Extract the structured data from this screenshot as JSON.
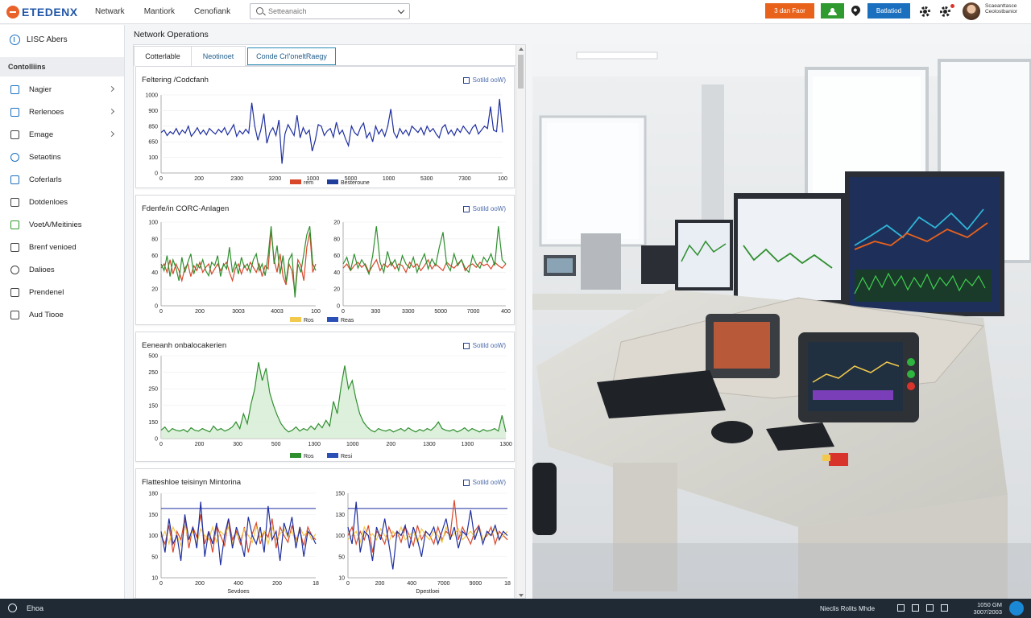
{
  "app": {
    "logo": "ETEDENX",
    "nav": [
      "Netwark",
      "Mantiork",
      "Cenofiank"
    ],
    "search_placeholder": "Setteanaich",
    "btn_orange": "3 dan Faor",
    "btn_blue": "Batlatiod",
    "user_line1": "Scaeanttasce",
    "user_line2": "Ceolostbanior"
  },
  "sidebar": {
    "header": "LISC Abers",
    "section": "Contolliins",
    "items": [
      {
        "label": "Nagier",
        "icon": "document-icon",
        "arrow": true
      },
      {
        "label": "Rerlenoes",
        "icon": "page-icon",
        "arrow": true
      },
      {
        "label": "Emage",
        "icon": "tag-icon",
        "arrow": true
      },
      {
        "label": "Setaotins",
        "icon": "clock-icon",
        "arrow": false
      },
      {
        "label": "Coferlarls",
        "icon": "card-icon",
        "arrow": false
      },
      {
        "label": "Dotdenloes",
        "icon": "grid-icon",
        "arrow": false
      },
      {
        "label": "VoetA/Meitinies",
        "icon": "chart-icon",
        "arrow": false
      },
      {
        "label": "Brenf venioed",
        "icon": "chart-bars-icon",
        "arrow": false
      },
      {
        "label": "Dalioes",
        "icon": "search-icon",
        "arrow": false
      },
      {
        "label": "Prendenel",
        "icon": "list-icon",
        "arrow": false
      },
      {
        "label": "Aud Tiooe",
        "icon": "star-icon",
        "arrow": false
      }
    ]
  },
  "main": {
    "title": "Network Operations",
    "tabs": [
      "Cotterlable",
      "Neotinoet",
      "Conde Crl'oneltRaegy"
    ],
    "panels": [
      {
        "title": "Feltering /Codcfanh",
        "link": "Sotild ooW)"
      },
      {
        "title": "Fdenfe/in CORC-Anlagen",
        "link": "Sotild ooW)"
      },
      {
        "title": "Eeneanh onbalocakerien",
        "link": "Sotild ooW)"
      },
      {
        "title": "Flatteshloe teisinyn Mintorina",
        "link": "Sotild ooW)"
      }
    ]
  },
  "chart_data": [
    {
      "type": "line",
      "panel": 1,
      "ytick_labels": [
        "1000",
        "900",
        "850",
        "650",
        "100",
        "0"
      ],
      "xtick_labels": [
        "0",
        "200",
        "2300",
        "3200",
        "1000",
        "5000",
        "1000",
        "5300",
        "7300",
        "100"
      ],
      "legend": [
        {
          "color": "#d9472b",
          "label": "rem"
        },
        {
          "color": "#1f3e9c",
          "label": "Besteroune"
        }
      ],
      "series_color": "#1f2fa0",
      "values": [
        0.52,
        0.55,
        0.48,
        0.53,
        0.5,
        0.57,
        0.49,
        0.55,
        0.51,
        0.6,
        0.47,
        0.52,
        0.58,
        0.5,
        0.55,
        0.49,
        0.57,
        0.53,
        0.5,
        0.56,
        0.52,
        0.58,
        0.49,
        0.55,
        0.62,
        0.47,
        0.54,
        0.5,
        0.56,
        0.51,
        0.9,
        0.6,
        0.42,
        0.55,
        0.76,
        0.38,
        0.52,
        0.58,
        0.48,
        0.68,
        0.12,
        0.5,
        0.62,
        0.55,
        0.48,
        0.74,
        0.45,
        0.58,
        0.5,
        0.55,
        0.28,
        0.42,
        0.62,
        0.6,
        0.48,
        0.54,
        0.57,
        0.46,
        0.65,
        0.5,
        0.55,
        0.44,
        0.35,
        0.6,
        0.52,
        0.48,
        0.58,
        0.64,
        0.45,
        0.52,
        0.4,
        0.6,
        0.5,
        0.56,
        0.47,
        0.6,
        0.82,
        0.52,
        0.45,
        0.57,
        0.5,
        0.55,
        0.48,
        0.6,
        0.56,
        0.52,
        0.58,
        0.49,
        0.6,
        0.53,
        0.57,
        0.5,
        0.45,
        0.58,
        0.62,
        0.5,
        0.55,
        0.48,
        0.57,
        0.52,
        0.6,
        0.55,
        0.5,
        0.58,
        0.62,
        0.5,
        0.55,
        0.6,
        0.57,
        0.85,
        0.55,
        0.53,
        0.95,
        0.52
      ]
    },
    {
      "type": "line",
      "panel": 2,
      "subchart": "left",
      "ytick_labels": [
        "100",
        "80",
        "60",
        "40",
        "20",
        "0"
      ],
      "xtick_labels": [
        "0",
        "200",
        "3003",
        "4003",
        "100"
      ],
      "series": [
        {
          "color": "#d9472b",
          "values": [
            0.45,
            0.5,
            0.4,
            0.55,
            0.38,
            0.5,
            0.42,
            0.3,
            0.45,
            0.5,
            0.35,
            0.48,
            0.42,
            0.52,
            0.4,
            0.46,
            0.5,
            0.38,
            0.44,
            0.5,
            0.42,
            0.48,
            0.52,
            0.4,
            0.3,
            0.45,
            0.5,
            0.38,
            0.48,
            0.42,
            0.52,
            0.46,
            0.4,
            0.5,
            0.35,
            0.48,
            0.44,
            0.9,
            0.55,
            0.4,
            0.62,
            0.35,
            0.25,
            0.5,
            0.42,
            0.15,
            0.55,
            0.48,
            0.3,
            0.7,
            0.88,
            0.4,
            0.5
          ]
        },
        {
          "color": "#2f8f2f",
          "values": [
            0.5,
            0.42,
            0.6,
            0.35,
            0.55,
            0.45,
            0.3,
            0.58,
            0.4,
            0.52,
            0.62,
            0.38,
            0.5,
            0.45,
            0.55,
            0.42,
            0.36,
            0.52,
            0.48,
            0.6,
            0.35,
            0.5,
            0.44,
            0.7,
            0.4,
            0.52,
            0.38,
            0.58,
            0.46,
            0.5,
            0.4,
            0.55,
            0.62,
            0.42,
            0.5,
            0.36,
            0.6,
            0.95,
            0.5,
            0.72,
            0.38,
            0.6,
            0.28,
            0.55,
            0.62,
            0.1,
            0.5,
            0.4,
            0.62,
            0.85,
            0.95,
            0.5,
            0.42
          ]
        }
      ]
    },
    {
      "type": "line",
      "panel": 2,
      "subchart": "right",
      "ytick_labels": [
        "20",
        "80",
        "60",
        "40",
        "20",
        "0"
      ],
      "xtick_labels": [
        "0",
        "300",
        "3300",
        "5000",
        "7000",
        "400"
      ],
      "legend": [
        {
          "color": "#f2c94c",
          "label": "Ros"
        },
        {
          "color": "#2a4fb5",
          "label": "Reas"
        }
      ],
      "series": [
        {
          "color": "#d9472b",
          "values": [
            0.45,
            0.5,
            0.42,
            0.48,
            0.52,
            0.46,
            0.5,
            0.4,
            0.48,
            0.55,
            0.42,
            0.5,
            0.46,
            0.52,
            0.44,
            0.5,
            0.48,
            0.4,
            0.52,
            0.46,
            0.5,
            0.42,
            0.48,
            0.55,
            0.44,
            0.5,
            0.46,
            0.42,
            0.52,
            0.48,
            0.45,
            0.5,
            0.55,
            0.42,
            0.48,
            0.5,
            0.46,
            0.52,
            0.48,
            0.5,
            0.44,
            0.52,
            0.48,
            0.45,
            0.5
          ]
        },
        {
          "color": "#2f8f2f",
          "values": [
            0.5,
            0.58,
            0.42,
            0.62,
            0.45,
            0.55,
            0.48,
            0.38,
            0.6,
            0.95,
            0.52,
            0.4,
            0.65,
            0.48,
            0.55,
            0.42,
            0.6,
            0.5,
            0.45,
            0.58,
            0.4,
            0.52,
            0.62,
            0.44,
            0.56,
            0.48,
            0.7,
            0.88,
            0.5,
            0.42,
            0.62,
            0.48,
            0.55,
            0.45,
            0.4,
            0.6,
            0.5,
            0.45,
            0.58,
            0.52,
            0.62,
            0.48,
            0.95,
            0.55,
            0.5
          ]
        }
      ]
    },
    {
      "type": "area",
      "panel": 3,
      "ytick_labels": [
        "500",
        "250",
        "250",
        "150",
        "150",
        "0"
      ],
      "xtick_labels": [
        "0",
        "200",
        "300",
        "500",
        "1300",
        "1000",
        "200",
        "1300",
        "1300",
        "1300"
      ],
      "legend": [
        {
          "color": "#2f8f2f",
          "label": "Ros"
        },
        {
          "color": "#2a4fb5",
          "label": "Resi"
        }
      ],
      "values": [
        0.1,
        0.14,
        0.08,
        0.12,
        0.1,
        0.09,
        0.11,
        0.08,
        0.13,
        0.1,
        0.09,
        0.12,
        0.1,
        0.08,
        0.15,
        0.1,
        0.12,
        0.09,
        0.11,
        0.14,
        0.2,
        0.12,
        0.3,
        0.18,
        0.42,
        0.6,
        0.92,
        0.7,
        0.85,
        0.55,
        0.4,
        0.28,
        0.18,
        0.12,
        0.08,
        0.1,
        0.14,
        0.09,
        0.12,
        0.1,
        0.15,
        0.11,
        0.18,
        0.13,
        0.22,
        0.15,
        0.45,
        0.3,
        0.62,
        0.88,
        0.6,
        0.7,
        0.48,
        0.3,
        0.2,
        0.14,
        0.1,
        0.08,
        0.12,
        0.1,
        0.09,
        0.11,
        0.08,
        0.1,
        0.12,
        0.09,
        0.13,
        0.1,
        0.08,
        0.11,
        0.09,
        0.12,
        0.1,
        0.14,
        0.2,
        0.12,
        0.1,
        0.09,
        0.11,
        0.08,
        0.1,
        0.13,
        0.09,
        0.12,
        0.1,
        0.08,
        0.11,
        0.09,
        0.1,
        0.12,
        0.09,
        0.28,
        0.08
      ]
    },
    {
      "type": "line",
      "panel": 4,
      "subchart": "left",
      "ytick_labels": [
        "180",
        "150",
        "100",
        "50",
        "10"
      ],
      "xtick_labels": [
        "0",
        "200",
        "400",
        "200",
        "18"
      ],
      "xlabel": "Sevdoes",
      "threshold": 0.82,
      "series": [
        {
          "color": "#d9472b",
          "values": [
            0.5,
            0.4,
            0.62,
            0.3,
            0.55,
            0.45,
            0.7,
            0.35,
            0.6,
            0.48,
            0.75,
            0.4,
            0.55,
            0.3,
            0.62,
            0.5,
            0.38,
            0.7,
            0.45,
            0.55,
            0.4,
            0.6,
            0.3,
            0.52,
            0.65,
            0.4,
            0.55,
            0.48,
            0.7,
            0.35,
            0.6,
            0.5,
            0.42,
            0.62,
            0.45,
            0.55,
            0.38,
            0.6,
            0.5,
            0.45
          ]
        },
        {
          "color": "#f2c94c",
          "values": [
            0.45,
            0.55,
            0.4,
            0.6,
            0.5,
            0.38,
            0.62,
            0.45,
            0.55,
            0.4,
            0.58,
            0.5,
            0.45,
            0.6,
            0.42,
            0.55,
            0.5,
            0.6,
            0.4,
            0.52,
            0.45,
            0.58,
            0.5,
            0.42,
            0.6,
            0.48,
            0.55,
            0.4,
            0.6,
            0.45,
            0.52,
            0.58,
            0.48,
            0.55,
            0.42,
            0.6,
            0.5,
            0.55,
            0.45,
            0.52
          ]
        },
        {
          "color": "#1f2fa0",
          "values": [
            0.55,
            0.3,
            0.7,
            0.4,
            0.5,
            0.2,
            0.75,
            0.45,
            0.6,
            0.35,
            0.9,
            0.25,
            0.55,
            0.4,
            0.65,
            0.15,
            0.5,
            0.7,
            0.35,
            0.6,
            0.45,
            0.25,
            0.72,
            0.5,
            0.4,
            0.6,
            0.3,
            0.85,
            0.45,
            0.55,
            0.2,
            0.65,
            0.5,
            0.72,
            0.35,
            0.6,
            0.25,
            0.55,
            0.5,
            0.4
          ]
        }
      ]
    },
    {
      "type": "line",
      "panel": 4,
      "subchart": "right",
      "ytick_labels": [
        "150",
        "130",
        "100",
        "50",
        "10"
      ],
      "xtick_labels": [
        "0",
        "200",
        "400",
        "7000",
        "9000",
        "18"
      ],
      "xlabel": "Dpestloei",
      "threshold": 0.82,
      "series": [
        {
          "color": "#d9472b",
          "values": [
            0.5,
            0.6,
            0.4,
            0.55,
            0.45,
            0.62,
            0.3,
            0.55,
            0.5,
            0.4,
            0.6,
            0.48,
            0.55,
            0.42,
            0.6,
            0.5,
            0.38,
            0.62,
            0.45,
            0.55,
            0.5,
            0.4,
            0.6,
            0.45,
            0.55,
            0.5,
            0.92,
            0.45,
            0.6,
            0.5,
            0.4,
            0.55,
            0.62,
            0.45,
            0.5,
            0.6,
            0.4,
            0.55,
            0.5,
            0.45
          ]
        },
        {
          "color": "#f2c94c",
          "values": [
            0.45,
            0.5,
            0.55,
            0.42,
            0.6,
            0.48,
            0.52,
            0.45,
            0.58,
            0.5,
            0.42,
            0.55,
            0.48,
            0.6,
            0.45,
            0.5,
            0.55,
            0.42,
            0.58,
            0.5,
            0.45,
            0.55,
            0.5,
            0.42,
            0.6,
            0.48,
            0.52,
            0.58,
            0.45,
            0.5,
            0.55,
            0.48,
            0.6,
            0.45,
            0.52,
            0.5,
            0.58,
            0.45,
            0.5,
            0.55
          ]
        },
        {
          "color": "#1f2fa0",
          "values": [
            0.6,
            0.4,
            0.9,
            0.3,
            0.55,
            0.5,
            0.2,
            0.6,
            0.45,
            0.7,
            0.4,
            0.1,
            0.55,
            0.5,
            0.62,
            0.35,
            0.6,
            0.45,
            0.25,
            0.55,
            0.5,
            0.6,
            0.4,
            0.55,
            0.7,
            0.45,
            0.6,
            0.35,
            0.55,
            0.5,
            0.8,
            0.45,
            0.6,
            0.4,
            0.55,
            0.5,
            0.62,
            0.45,
            0.55,
            0.5
          ]
        }
      ]
    }
  ],
  "taskbar": {
    "left_label": "Ehoa",
    "right_label": "Nieclis Rolits Mhde",
    "clock_time": "1050 GM",
    "clock_date": "3007/2003"
  }
}
